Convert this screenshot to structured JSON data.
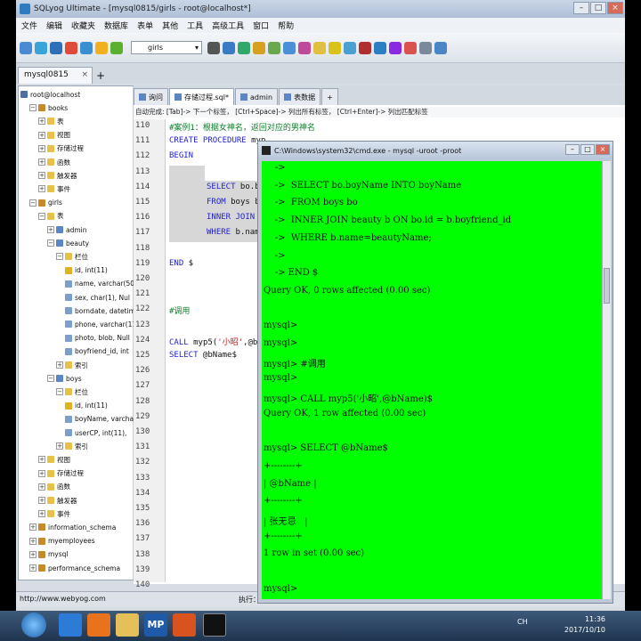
{
  "window": {
    "title": "SQLyog Ultimate - [mysql0815/girls - root@localhost*]",
    "min": "–",
    "max": "□",
    "close": "×"
  },
  "menu": [
    "文件",
    "编辑",
    "收藏夹",
    "数据库",
    "表单",
    "其他",
    "工具",
    "高级工具",
    "窗口",
    "帮助"
  ],
  "toolbar": {
    "db_select": "girls"
  },
  "connection_tab": {
    "label": "mysql0815",
    "close": "×",
    "add": "+"
  },
  "tree": {
    "items": [
      {
        "label": "root@localhost",
        "indent": 0,
        "icon": "server",
        "exp": ""
      },
      {
        "label": "books",
        "indent": 1,
        "icon": "db",
        "exp": "−"
      },
      {
        "label": "表",
        "indent": 2,
        "icon": "folder",
        "exp": "+"
      },
      {
        "label": "视图",
        "indent": 2,
        "icon": "folder",
        "exp": "+"
      },
      {
        "label": "存储过程",
        "indent": 2,
        "icon": "folder",
        "exp": "+"
      },
      {
        "label": "函数",
        "indent": 2,
        "icon": "folder",
        "exp": "+"
      },
      {
        "label": "触发器",
        "indent": 2,
        "icon": "folder",
        "exp": "+"
      },
      {
        "label": "事件",
        "indent": 2,
        "icon": "folder",
        "exp": "+"
      },
      {
        "label": "girls",
        "indent": 1,
        "icon": "db",
        "exp": "−"
      },
      {
        "label": "表",
        "indent": 2,
        "icon": "folder",
        "exp": "−"
      },
      {
        "label": "admin",
        "indent": 3,
        "icon": "tbl",
        "exp": "+"
      },
      {
        "label": "beauty",
        "indent": 3,
        "icon": "tbl",
        "exp": "−"
      },
      {
        "label": "栏位",
        "indent": 4,
        "icon": "folder",
        "exp": "−"
      },
      {
        "label": "id, int(11)",
        "indent": 5,
        "icon": "key",
        "exp": ""
      },
      {
        "label": "name, varchar(50)",
        "indent": 5,
        "icon": "col",
        "exp": ""
      },
      {
        "label": "sex, char(1), Nul",
        "indent": 5,
        "icon": "col",
        "exp": ""
      },
      {
        "label": "borndate, datetim",
        "indent": 5,
        "icon": "col",
        "exp": ""
      },
      {
        "label": "phone, varchar(11",
        "indent": 5,
        "icon": "col",
        "exp": ""
      },
      {
        "label": "photo, blob, Null",
        "indent": 5,
        "icon": "col",
        "exp": ""
      },
      {
        "label": "boyfriend_id, int",
        "indent": 5,
        "icon": "col",
        "exp": ""
      },
      {
        "label": "索引",
        "indent": 4,
        "icon": "folder",
        "exp": "+"
      },
      {
        "label": "boys",
        "indent": 3,
        "icon": "tbl",
        "exp": "−"
      },
      {
        "label": "栏位",
        "indent": 4,
        "icon": "folder",
        "exp": "−"
      },
      {
        "label": "id, int(11)",
        "indent": 5,
        "icon": "key",
        "exp": ""
      },
      {
        "label": "boyName, varchar(",
        "indent": 5,
        "icon": "col",
        "exp": ""
      },
      {
        "label": "userCP, int(11),",
        "indent": 5,
        "icon": "col",
        "exp": ""
      },
      {
        "label": "索引",
        "indent": 4,
        "icon": "folder",
        "exp": "+"
      },
      {
        "label": "视图",
        "indent": 2,
        "icon": "folder",
        "exp": "+"
      },
      {
        "label": "存储过程",
        "indent": 2,
        "icon": "folder",
        "exp": "+"
      },
      {
        "label": "函数",
        "indent": 2,
        "icon": "folder",
        "exp": "+"
      },
      {
        "label": "触发器",
        "indent": 2,
        "icon": "folder",
        "exp": "+"
      },
      {
        "label": "事件",
        "indent": 2,
        "icon": "folder",
        "exp": "+"
      },
      {
        "label": "information_schema",
        "indent": 1,
        "icon": "db",
        "exp": "+"
      },
      {
        "label": "myemployees",
        "indent": 1,
        "icon": "db",
        "exp": "+"
      },
      {
        "label": "mysql",
        "indent": 1,
        "icon": "db",
        "exp": "+"
      },
      {
        "label": "performance_schema",
        "indent": 1,
        "icon": "db",
        "exp": "+"
      }
    ]
  },
  "editor_tabs": [
    {
      "label": "询问",
      "active": false
    },
    {
      "label": "存储过程.sql*",
      "active": true
    },
    {
      "label": "admin",
      "active": false
    },
    {
      "label": "表数据",
      "active": false
    },
    {
      "label": "+",
      "active": false
    }
  ],
  "hint": "自动完成: [Tab]-> 下一个标签， [Ctrl+Space]-> 列出所有标签， [Ctrl+Enter]-> 列出匹配标签",
  "line_numbers": [
    "110",
    "111",
    "112",
    "113",
    "114",
    "115",
    "116",
    "117",
    "118",
    "119",
    "120",
    "121",
    "122",
    "123",
    "124",
    "125",
    "126",
    "127",
    "128",
    "129",
    "130",
    "131",
    "132",
    "133",
    "134",
    "135",
    "136",
    "137",
    "138",
    "139",
    "140"
  ],
  "code_lines": [
    {
      "row": 0,
      "indent": 0,
      "parts": [
        {
          "t": "#案例1：根据女神名，返回对应的男神名",
          "c": "cm"
        }
      ]
    },
    {
      "row": 1,
      "indent": 0,
      "parts": [
        {
          "t": "CREATE PROCEDURE",
          "c": "kw"
        },
        {
          "t": " myp",
          "c": ""
        }
      ]
    },
    {
      "row": 2,
      "indent": 0,
      "parts": [
        {
          "t": "BEGIN",
          "c": "kw"
        }
      ]
    },
    {
      "row": 4,
      "indent": 6,
      "parts": [
        {
          "t": "SELECT",
          "c": "kw"
        },
        {
          "t": " bo.bo",
          "c": ""
        }
      ]
    },
    {
      "row": 5,
      "indent": 6,
      "parts": [
        {
          "t": "FROM",
          "c": "kw"
        },
        {
          "t": " boys b",
          "c": ""
        }
      ]
    },
    {
      "row": 6,
      "indent": 6,
      "parts": [
        {
          "t": "INNER JOIN",
          "c": "kw"
        },
        {
          "t": " b",
          "c": ""
        }
      ]
    },
    {
      "row": 7,
      "indent": 6,
      "parts": [
        {
          "t": "WHERE",
          "c": "kw"
        },
        {
          "t": " b.name",
          "c": ""
        }
      ]
    },
    {
      "row": 9,
      "indent": 0,
      "parts": [
        {
          "t": "END",
          "c": "kw"
        },
        {
          "t": " $",
          "c": ""
        }
      ]
    },
    {
      "row": 12,
      "indent": 0,
      "parts": [
        {
          "t": "#调用",
          "c": "cm"
        }
      ]
    },
    {
      "row": 14,
      "indent": 0,
      "parts": [
        {
          "t": "CALL",
          "c": "kw"
        },
        {
          "t": " myp5(",
          "c": ""
        },
        {
          "t": "'小昭'",
          "c": "str"
        },
        {
          "t": ",@b",
          "c": ""
        }
      ]
    },
    {
      "row": 15,
      "indent": 0,
      "parts": [
        {
          "t": "SELECT",
          "c": "kw"
        },
        {
          "t": " @bName$",
          "c": ""
        }
      ]
    }
  ],
  "statusbar": {
    "url": "http://www.webyog.com",
    "exec": "执行："
  },
  "cmd": {
    "title": "C:\\Windows\\system32\\cmd.exe - mysql  -uroot -proot",
    "min": "–",
    "max": "□",
    "close": "×",
    "lines": [
      {
        "row": 0,
        "text": "    ->"
      },
      {
        "row": 1,
        "text": "    ->  SELECT bo.boyName INTO boyName"
      },
      {
        "row": 2,
        "text": "    ->  FROM boys bo"
      },
      {
        "row": 3,
        "text": "    ->  INNER JOIN beauty b ON bo.id = b.boyfriend_id"
      },
      {
        "row": 4,
        "text": "    ->  WHERE b.name=beautyName;"
      },
      {
        "row": 5,
        "text": "    ->"
      },
      {
        "row": 6,
        "text": "    -> END $"
      },
      {
        "row": 7,
        "text": "Query OK, 0 rows affected (0.00 sec)"
      },
      {
        "row": 9,
        "text": "mysql>"
      },
      {
        "row": 10,
        "text": "mysql>"
      },
      {
        "row": 11,
        "text": "mysql> #调用"
      },
      {
        "row": 12,
        "text": "mysql>"
      },
      {
        "row": 13,
        "text": "mysql> CALL myp5('小昭',@bName)$"
      },
      {
        "row": 14,
        "text": "Query OK, 1 row affected (0.00 sec)"
      },
      {
        "row": 16,
        "text": "mysql> SELECT @bName$"
      },
      {
        "row": 17,
        "text": "+--------+"
      },
      {
        "row": 18,
        "text": "| @bName |"
      },
      {
        "row": 19,
        "text": "+--------+"
      },
      {
        "row": 20,
        "text": "| 张无忌   |"
      },
      {
        "row": 21,
        "text": "+--------+"
      },
      {
        "row": 22,
        "text": "1 row in set (0.00 sec)"
      },
      {
        "row": 24,
        "text": "mysql>"
      }
    ]
  },
  "taskbar": {
    "apps": [
      "ie",
      "firefox",
      "folder",
      "MP",
      "office",
      "cmd"
    ],
    "mp_label": "MP",
    "lang": "CH",
    "time": "11:36",
    "date": "2017/10/10"
  },
  "colors": {
    "console_bg": "#00ff00",
    "keyword": "#2222cc",
    "comment": "#0a7f2a",
    "string": "#c01a1a"
  }
}
